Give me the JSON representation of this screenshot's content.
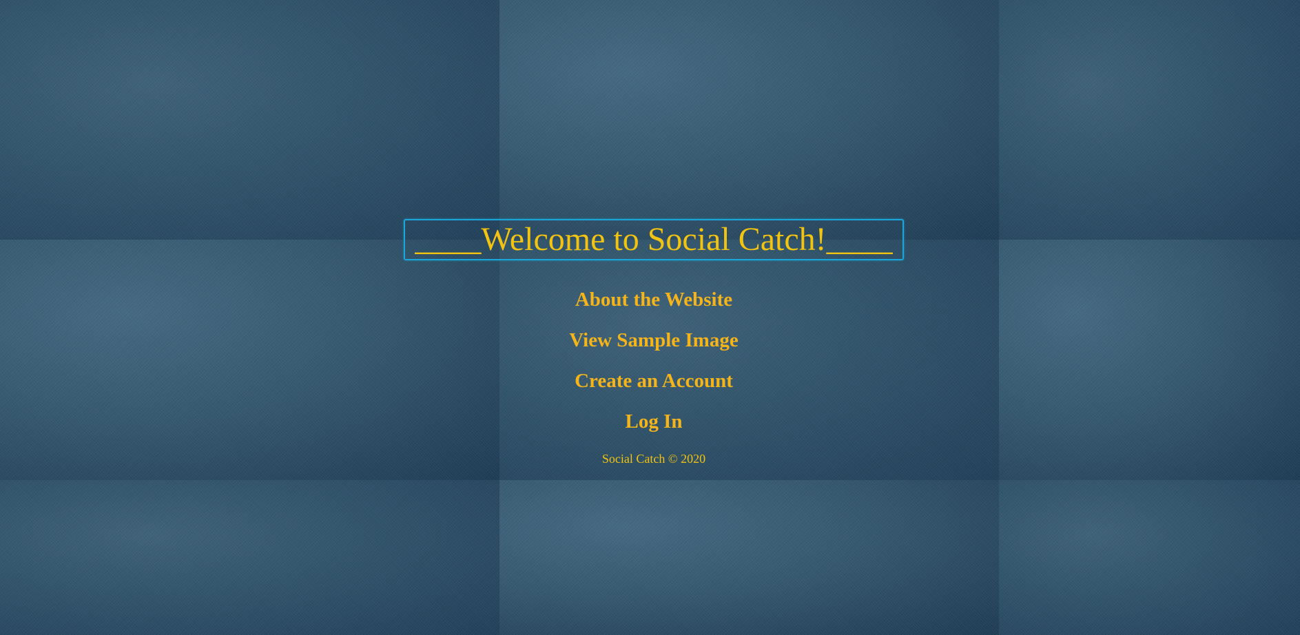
{
  "header": {
    "title": "____Welcome to Social Catch!____"
  },
  "nav": {
    "items": [
      {
        "label": "About the Website"
      },
      {
        "label": "View Sample Image"
      },
      {
        "label": "Create an Account"
      },
      {
        "label": "Log In"
      }
    ]
  },
  "footer": {
    "text": "Social Catch © 2020"
  },
  "colors": {
    "text_accent": "#f3c312",
    "title_border": "#1aa6d9",
    "background": "#2f5066"
  }
}
